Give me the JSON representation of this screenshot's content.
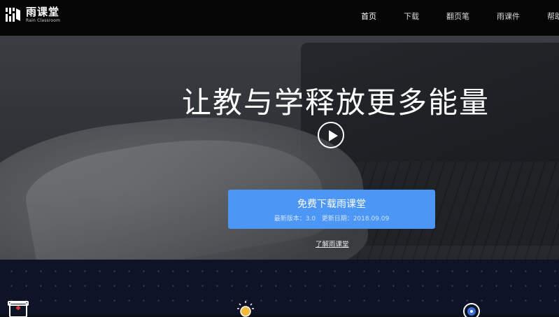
{
  "brand": {
    "name_cn": "雨课堂",
    "name_en": "Rain Classroom"
  },
  "nav": {
    "items": [
      {
        "label": "首页",
        "active": true
      },
      {
        "label": "下载",
        "active": false
      },
      {
        "label": "翻页笔",
        "active": false
      },
      {
        "label": "雨课件",
        "active": false
      },
      {
        "label": "帮助",
        "active": false
      }
    ]
  },
  "hero": {
    "title": "让教与学释放更多能量",
    "download_button": {
      "label": "免费下载雨课堂",
      "version_label": "最新版本：3.0",
      "update_label": "更新日期：2018.09.09"
    },
    "learn_more": "了解雨课堂"
  },
  "features": {
    "icons": [
      "badge-icon",
      "lightbulb-icon",
      "target-icon"
    ]
  },
  "colors": {
    "accent": "#4c96f5",
    "nav_bg": "#050506",
    "features_bg": "#0e1426"
  }
}
